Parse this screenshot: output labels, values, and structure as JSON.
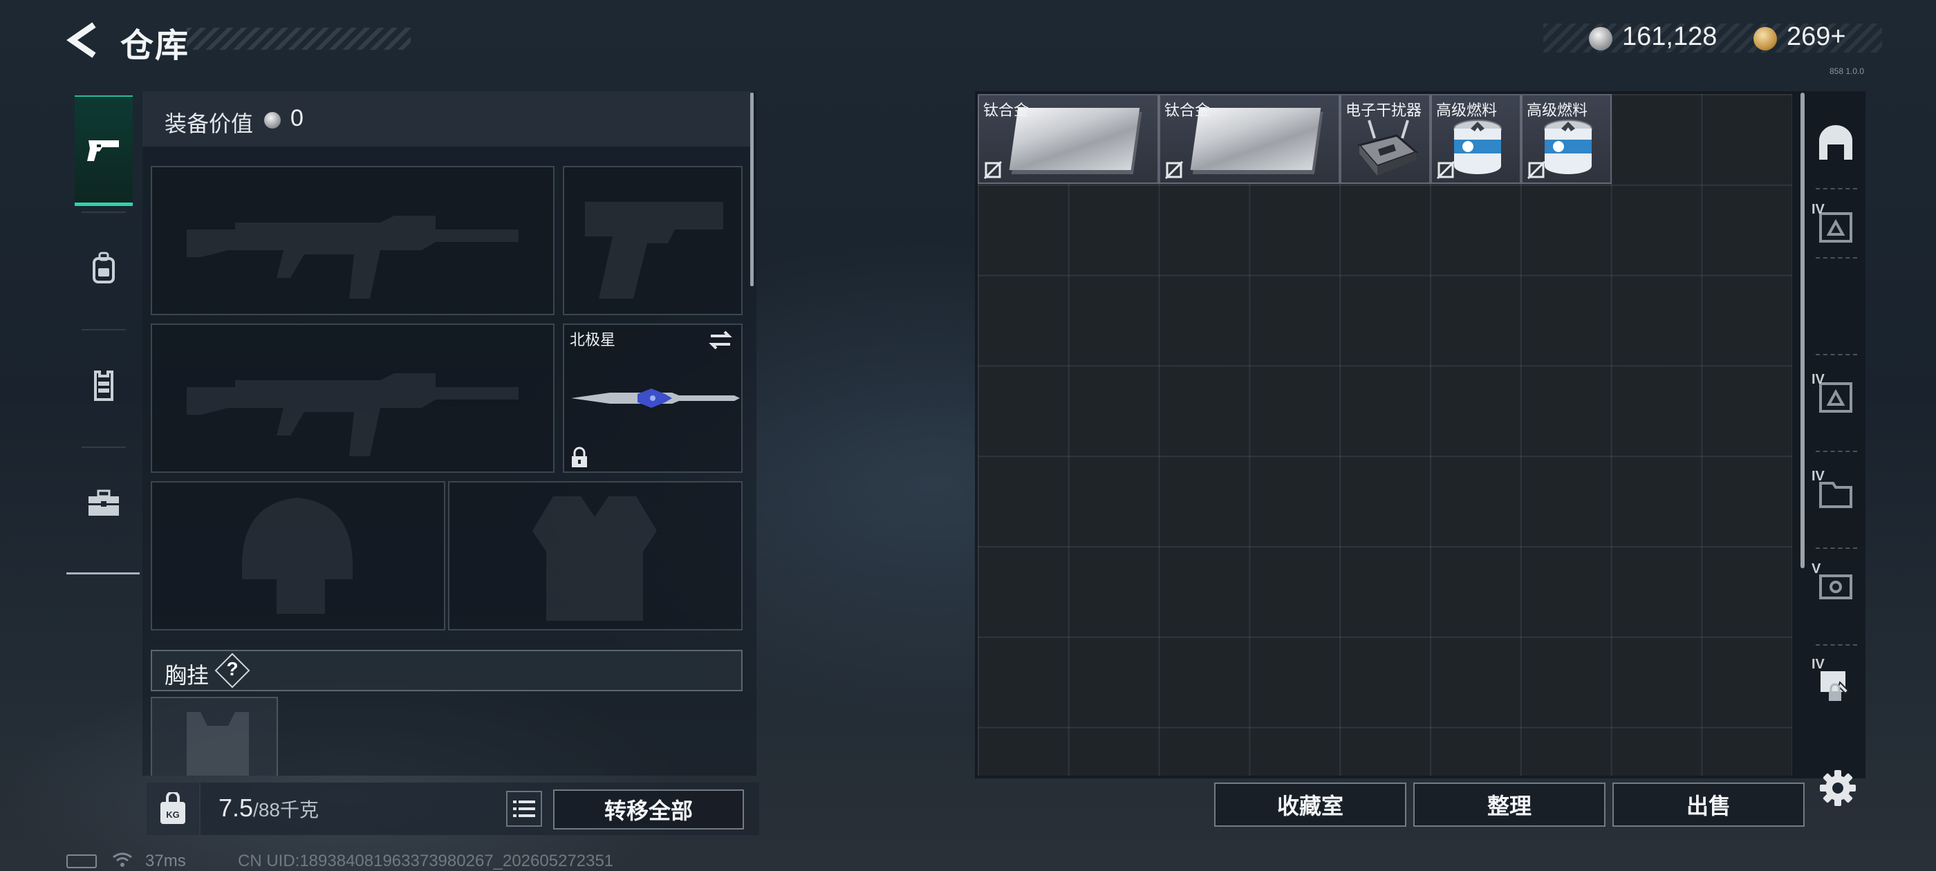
{
  "header": {
    "title": "仓库"
  },
  "currency": {
    "money": "161,128",
    "tokens": "269",
    "tokens_plus": "+",
    "tiny": "858 1.0.0"
  },
  "left_tabs": [
    "weapons",
    "backpack",
    "chest-rig",
    "case"
  ],
  "equipment": {
    "value_label": "装备价值",
    "value": "0",
    "melee_name": "北极星",
    "rig_label": "胸挂",
    "rig_help": "?"
  },
  "footer": {
    "weight_icon_text": "KG",
    "weight_current": "7.5",
    "weight_max": "/88千克",
    "transfer_all": "转移全部"
  },
  "storage": {
    "columns": 9,
    "items": [
      {
        "name": "钛合金",
        "kind": "plate"
      },
      {
        "name": "钛合金",
        "kind": "plate"
      },
      {
        "name": "电子干扰器",
        "kind": "jammer"
      },
      {
        "name": "高级燃料",
        "kind": "fuel"
      },
      {
        "name": "高级燃料",
        "kind": "fuel"
      }
    ],
    "side_levels": [
      "",
      "IV",
      "IV",
      "IV",
      "V",
      "IV",
      ""
    ]
  },
  "actions": {
    "collection": "收藏室",
    "sort": "整理",
    "sell": "出售"
  },
  "status": {
    "ping": "37ms",
    "uid": "CN UID:189384081963373980267_202605272351"
  },
  "colors": {
    "accent": "#2fd3ac",
    "panel": "#1f2429"
  }
}
